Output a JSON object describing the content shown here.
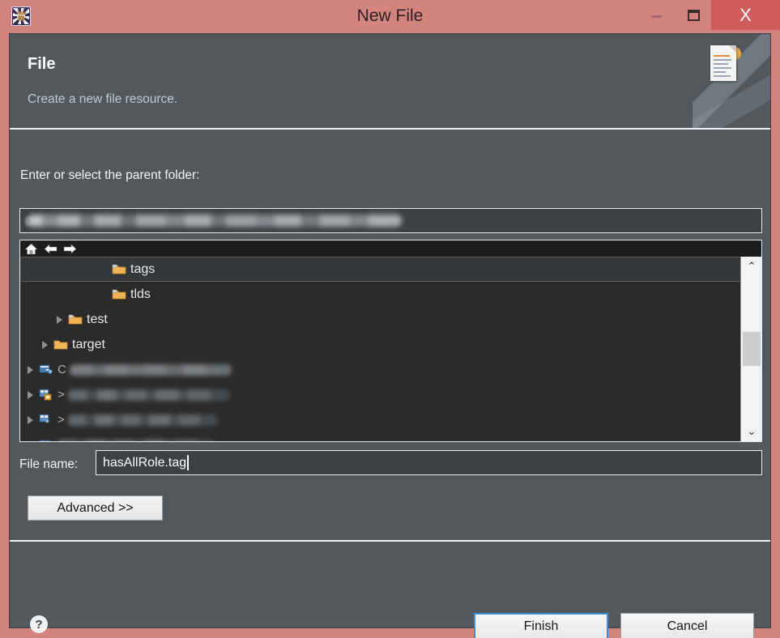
{
  "window": {
    "title": "New File",
    "app_icon_name": "java-ee-ide-icon",
    "app_icon_glyph_top": "Java EE",
    "app_icon_glyph_bottom": "IDE",
    "minimize_label": "Minimize",
    "maximize_label": "Maximize",
    "close_label": "X",
    "titlebar_color": "#d4847f",
    "close_button_color": "#cf5b5b"
  },
  "header": {
    "title": "File",
    "description": "Create a new file resource.",
    "banner_icon_name": "new-file-banner-icon"
  },
  "content": {
    "parent_folder_label": "Enter or select the parent folder:",
    "parent_folder_value": "",
    "parent_folder_redacted": true,
    "tree_toolbar": [
      {
        "name": "home-icon",
        "label": "Home"
      },
      {
        "name": "back-arrow-icon",
        "label": "Back"
      },
      {
        "name": "forward-arrow-icon",
        "label": "Forward"
      }
    ],
    "tree_rows": [
      {
        "label": "tags",
        "icon": "folder-source-icon",
        "indent": 5,
        "twisty": "none",
        "selected": true,
        "redacted": false
      },
      {
        "label": "tlds",
        "icon": "folder-source-icon",
        "indent": 5,
        "twisty": "none",
        "selected": false,
        "redacted": false
      },
      {
        "label": "test",
        "icon": "folder-source-icon",
        "indent": 2,
        "twisty": "closed",
        "selected": false,
        "redacted": false
      },
      {
        "label": "target",
        "icon": "folder-plain-icon",
        "indent": 1,
        "twisty": "closed",
        "selected": false,
        "redacted": false
      },
      {
        "label": "",
        "icon": "project-web-icon",
        "indent": 0,
        "twisty": "closed",
        "selected": false,
        "redacted": true,
        "prefix": "C"
      },
      {
        "label": "",
        "icon": "project-maven-icon",
        "indent": 0,
        "twisty": "closed",
        "selected": false,
        "redacted": true,
        "prefix": ">"
      },
      {
        "label": "",
        "icon": "project-star-icon",
        "indent": 0,
        "twisty": "closed",
        "selected": false,
        "redacted": true,
        "prefix": ">"
      },
      {
        "label": "",
        "icon": "project-web-icon",
        "indent": 0,
        "twisty": "closed",
        "selected": false,
        "redacted": true,
        "prefix": ""
      }
    ],
    "scrollbar": {
      "up_arrow": "⌃",
      "down_arrow": "⌄",
      "thumb_position_pct": 50
    },
    "file_name_label": "File name:",
    "file_name_value": "hasAllRole.tag",
    "advanced_label": "Advanced >>"
  },
  "footer": {
    "help_label": "?",
    "finish_label": "Finish",
    "cancel_label": "Cancel",
    "focus_color": "#3f8fd0"
  },
  "colors": {
    "dialog_background": "#53585c",
    "tree_background": "#2b2b2b",
    "tree_toolbar_background": "#1d1d1d",
    "input_background": "#3c4145",
    "separator": "#eef1f3",
    "header_description": "#b9cdd6"
  }
}
